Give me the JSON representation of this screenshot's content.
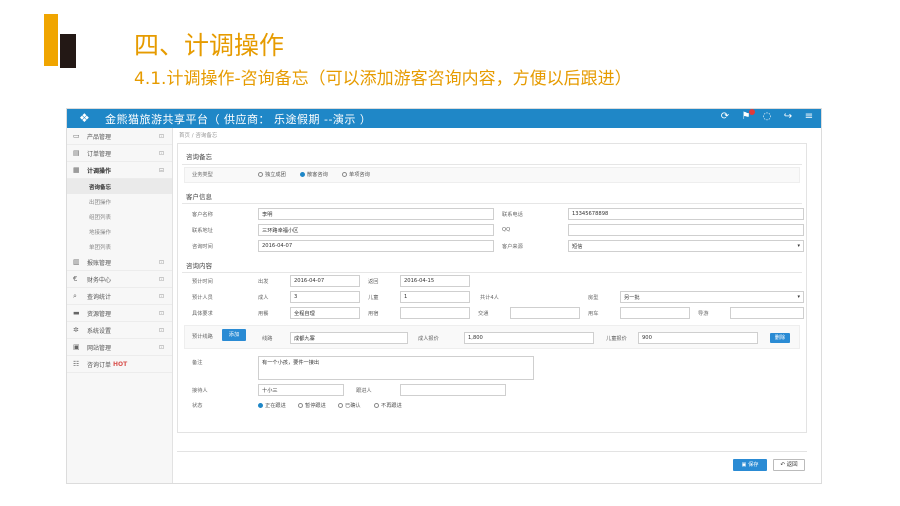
{
  "slide": {
    "title": "四、计调操作",
    "subtitle": "4.1.计调操作-咨询备忘（可以添加游客咨询内容，方便以后跟进）"
  },
  "app": {
    "title": "金熊猫旅游共享平台（ 供应商： 乐途假期 --演示 ）",
    "top_icons": [
      "refresh-icon",
      "notification-icon",
      "chat-icon",
      "logout-icon",
      "menu-icon"
    ]
  },
  "sidebar": {
    "items": [
      {
        "icon": "cart-icon",
        "glyph": "🛒",
        "label": "产品管理"
      },
      {
        "icon": "order-icon",
        "glyph": "▤",
        "label": "订单管理"
      },
      {
        "icon": "dispatch-icon",
        "glyph": "▦",
        "label": "计调操作"
      }
    ],
    "subitems": [
      {
        "label": "咨询备忘",
        "active": true
      },
      {
        "label": "出团操作",
        "active": false
      },
      {
        "label": "组团列表",
        "active": false
      },
      {
        "label": "地接操作",
        "active": false
      },
      {
        "label": "单团列表",
        "active": false
      }
    ],
    "items2": [
      {
        "icon": "ledger-icon",
        "glyph": "▥",
        "label": "报账管理"
      },
      {
        "icon": "finance-icon",
        "glyph": "€",
        "label": "财务中心"
      },
      {
        "icon": "search-icon",
        "glyph": "⌕",
        "label": "查询统计"
      },
      {
        "icon": "resource-icon",
        "glyph": "▬",
        "label": "资源管理"
      },
      {
        "icon": "settings-icon",
        "glyph": "✲",
        "label": "系统设置"
      },
      {
        "icon": "site-icon",
        "glyph": "▣",
        "label": "网站管理"
      },
      {
        "icon": "consult-icon",
        "glyph": "☷",
        "label": "咨询订单",
        "badge": "HOT"
      }
    ]
  },
  "breadcrumb": "首页 / 咨询备忘",
  "form": {
    "section1_title": "咨询备忘",
    "business_type_label": "业务类型",
    "business_types": [
      {
        "label": "独立成团",
        "checked": false
      },
      {
        "label": "散客咨询",
        "checked": true
      },
      {
        "label": "单项咨询",
        "checked": false
      }
    ],
    "section2_title": "客户信息",
    "customer_name_label": "客户名称",
    "customer_name": "李明",
    "phone_label": "联系电话",
    "phone": "13345678898",
    "address_label": "联系地址",
    "address": "三环路幸福小区",
    "qq_label": "QQ",
    "qq": "",
    "consult_time_label": "咨询时间",
    "consult_time": "2016-04-07",
    "source_label": "客户来源",
    "source": "短信",
    "section3_title": "咨询内容",
    "plan_time_label": "预计时间",
    "depart_label": "出发",
    "depart_date": "2016-04-07",
    "return_label": "返回",
    "return_date": "2016-04-15",
    "people_label": "预计人员",
    "adult_label": "成人",
    "adult_count": "3",
    "child_label": "儿童",
    "child_count": "1",
    "total_label": "共计4人",
    "room_label": "房型",
    "room_value": "另一批",
    "req_label": "具体要求",
    "meal_label": "用餐",
    "meal_value": "全程自理",
    "hotel_label": "用宿",
    "hotel_value": "",
    "flight_label": "交通",
    "flight_value": "",
    "car_label": "用车",
    "car_value": "",
    "other_label": "导游",
    "other_value": "",
    "route_label": "预计线路",
    "add_button": "添加",
    "route_name_label": "线路",
    "route_name": "成都九寨",
    "adult_price_label": "成人报价",
    "adult_price": "1,800",
    "child_price_label": "儿童报价",
    "child_price": "900",
    "delete_button": "删除",
    "note_label": "备注",
    "note": "有一个小孩，要件一接出",
    "handler_label": "接待人",
    "handler": "十小三",
    "follow_label": "跟进人",
    "follow": "",
    "status_label": "状态",
    "statuses": [
      {
        "label": "正在跟进",
        "checked": true
      },
      {
        "label": "暂停跟进",
        "checked": false
      },
      {
        "label": "已确认",
        "checked": false
      },
      {
        "label": "不再跟进",
        "checked": false
      }
    ],
    "save_button": "保存",
    "back_button": "返回"
  }
}
